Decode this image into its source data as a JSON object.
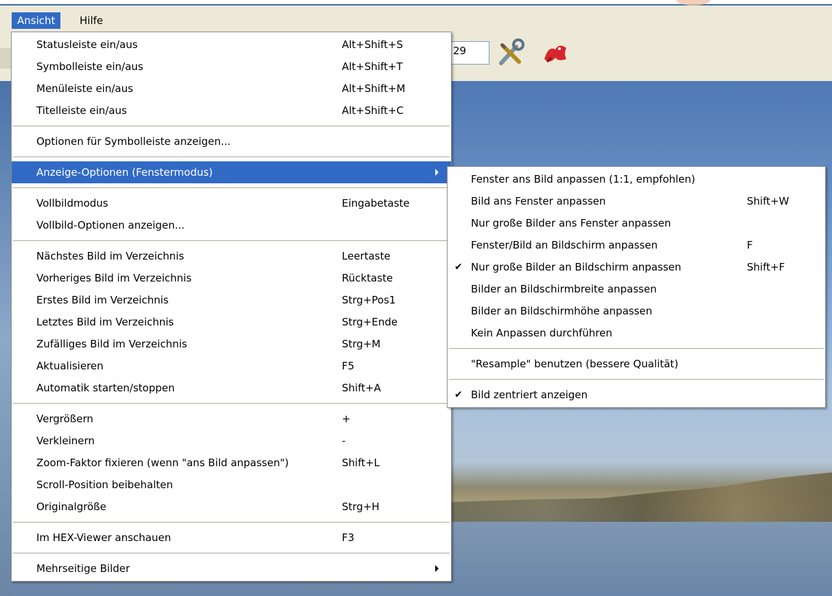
{
  "menubar": {
    "items": [
      {
        "label": "Ansicht",
        "active": true
      },
      {
        "label": "Hilfe",
        "active": false
      }
    ]
  },
  "toolbar": {
    "zoom_value": "29",
    "icons": [
      "tools-icon",
      "red-bird-icon"
    ]
  },
  "colors": {
    "highlight": "#316ac5",
    "menubar": "#ece9d8"
  },
  "view_menu": {
    "groups": [
      [
        {
          "label": "Statusleiste ein/aus",
          "shortcut": "Alt+Shift+S"
        },
        {
          "label": "Symbolleiste ein/aus",
          "shortcut": "Alt+Shift+T"
        },
        {
          "label": "Menüleiste ein/aus",
          "shortcut": "Alt+Shift+M"
        },
        {
          "label": "Titelleiste ein/aus",
          "shortcut": "Alt+Shift+C"
        }
      ],
      [
        {
          "label": "Optionen für Symbolleiste anzeigen...",
          "shortcut": ""
        }
      ],
      [
        {
          "label": "Anzeige-Optionen (Fenstermodus)",
          "shortcut": "",
          "submenu": true,
          "highlighted": true
        }
      ],
      [
        {
          "label": "Vollbildmodus",
          "shortcut": "Eingabetaste"
        },
        {
          "label": "Vollbild-Optionen anzeigen...",
          "shortcut": ""
        }
      ],
      [
        {
          "label": "Nächstes Bild im Verzeichnis",
          "shortcut": "Leertaste"
        },
        {
          "label": "Vorheriges Bild im Verzeichnis",
          "shortcut": "Rücktaste"
        },
        {
          "label": "Erstes Bild im Verzeichnis",
          "shortcut": "Strg+Pos1"
        },
        {
          "label": "Letztes Bild im Verzeichnis",
          "shortcut": "Strg+Ende"
        },
        {
          "label": "Zufälliges Bild im Verzeichnis",
          "shortcut": "Strg+M"
        },
        {
          "label": "Aktualisieren",
          "shortcut": "F5"
        },
        {
          "label": "Automatik starten/stoppen",
          "shortcut": "Shift+A"
        }
      ],
      [
        {
          "label": "Vergrößern",
          "shortcut": "+"
        },
        {
          "label": "Verkleinern",
          "shortcut": "-"
        },
        {
          "label": "Zoom-Faktor fixieren (wenn \"ans Bild anpassen\")",
          "shortcut": "Shift+L"
        },
        {
          "label": "Scroll-Position beibehalten",
          "shortcut": ""
        },
        {
          "label": "Originalgröße",
          "shortcut": "Strg+H"
        }
      ],
      [
        {
          "label": "Im HEX-Viewer anschauen",
          "shortcut": "F3"
        }
      ],
      [
        {
          "label": "Mehrseitige Bilder",
          "shortcut": "",
          "submenu": true
        }
      ]
    ]
  },
  "display_options_menu": {
    "groups": [
      [
        {
          "label": "Fenster ans Bild anpassen (1:1, empfohlen)",
          "shortcut": ""
        },
        {
          "label": "Bild ans Fenster anpassen",
          "shortcut": "Shift+W"
        },
        {
          "label": "Nur große Bilder ans Fenster anpassen",
          "shortcut": ""
        },
        {
          "label": "Fenster/Bild an Bildschirm anpassen",
          "shortcut": "F"
        },
        {
          "label": "Nur große Bilder an Bildschirm anpassen",
          "shortcut": "Shift+F",
          "checked": true
        },
        {
          "label": "Bilder an Bildschirmbreite anpassen",
          "shortcut": ""
        },
        {
          "label": "Bilder an Bildschirmhöhe anpassen",
          "shortcut": ""
        },
        {
          "label": "Kein Anpassen durchführen",
          "shortcut": ""
        }
      ],
      [
        {
          "label": "\"Resample\" benutzen (bessere Qualität)",
          "shortcut": ""
        }
      ],
      [
        {
          "label": "Bild zentriert anzeigen",
          "shortcut": "",
          "checked": true
        }
      ]
    ]
  }
}
